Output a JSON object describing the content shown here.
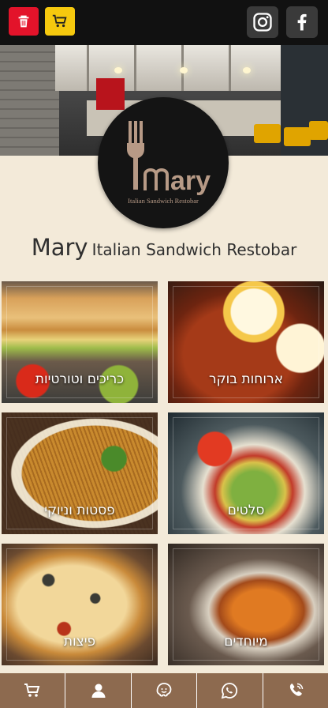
{
  "header": {
    "trash_icon": "trash-icon",
    "cart_icon": "cart-icon",
    "instagram_icon": "instagram-icon",
    "facebook_icon": "facebook-icon",
    "colors": {
      "trash": "#e3132a",
      "cart": "#f6c90e",
      "social": "#3a3a3a"
    }
  },
  "logo": {
    "word": "ary",
    "tagline": "Italian Sandwich Restobar"
  },
  "brand": {
    "name": "Mary",
    "subtitle": "Italian Sandwich Restobar"
  },
  "categories": [
    {
      "label": "ארוחות בוקר",
      "image": "shakshuka"
    },
    {
      "label": "כריכים וטורטיות",
      "image": "sandwich"
    },
    {
      "label": "סלטים",
      "image": "salad"
    },
    {
      "label": "פסטות וניוקי",
      "image": "pasta"
    },
    {
      "label": "מיוחדים",
      "image": "noodles"
    },
    {
      "label": "פיצות",
      "image": "pizza"
    }
  ],
  "bottom_nav": [
    {
      "icon": "cart-icon"
    },
    {
      "icon": "user-icon"
    },
    {
      "icon": "waze-icon"
    },
    {
      "icon": "whatsapp-icon"
    },
    {
      "icon": "phone-icon"
    }
  ],
  "colors": {
    "bottom_bar": "#8d6a4f",
    "page_bg": "#f3ead9"
  }
}
